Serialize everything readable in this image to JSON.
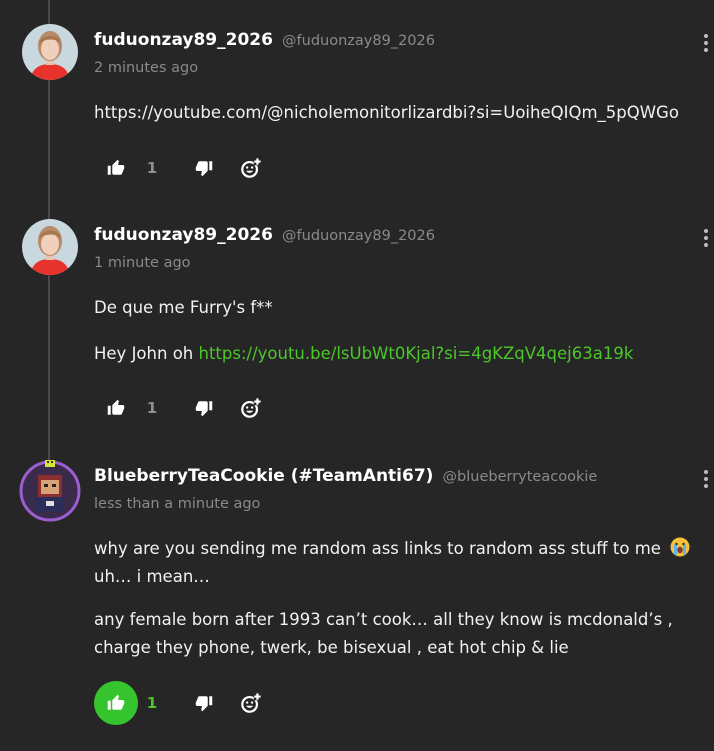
{
  "comments": [
    {
      "username": "fuduonzay89_2026",
      "handle": "@fuduonzay89_2026",
      "timestamp": "2 minutes ago",
      "avatar": "woman-red-shirt-avatar",
      "lines": [
        {
          "text": "https://youtube.com/@nicholemonitorlizardbi?si=UoiheQIQm_5pQWGo"
        }
      ],
      "likes": "1",
      "liked": false
    },
    {
      "username": "fuduonzay89_2026",
      "handle": "@fuduonzay89_2026",
      "timestamp": "1 minute ago",
      "avatar": "woman-red-shirt-avatar",
      "lines": [
        {
          "text": "De que me Furry's f**"
        },
        {
          "prefix": "Hey John oh ",
          "link": "https://youtu.be/lsUbWt0Kjal?si=4gKZqV4qej63a19k"
        }
      ],
      "likes": "1",
      "liked": false
    },
    {
      "username": "BlueberryTeaCookie (#TeamAnti67)",
      "handle": "@blueberryteacookie",
      "timestamp": "less than a minute ago",
      "avatar": "pixel-character-avatar",
      "lines": [
        {
          "text": "why are you sending me random ass links to random ass stuff to me"
        },
        {
          "text": "uh… i mean…"
        },
        {
          "text": "any female born after 1993 can’t cook… all they know is mcdonald’s ,"
        },
        {
          "text": "charge they phone, twerk, be bisexual , eat hot chip & lie"
        }
      ],
      "emoji": "crying-face-emoji",
      "likes": "1",
      "liked": true
    }
  ],
  "colors": {
    "background": "#262626",
    "accent_green": "#35c42d",
    "link_green": "#4cc72a",
    "muted_text": "#8a8a8a"
  },
  "icons": [
    "thumbs-up-icon",
    "thumbs-down-icon",
    "add-reaction-icon",
    "more-options-icon"
  ]
}
